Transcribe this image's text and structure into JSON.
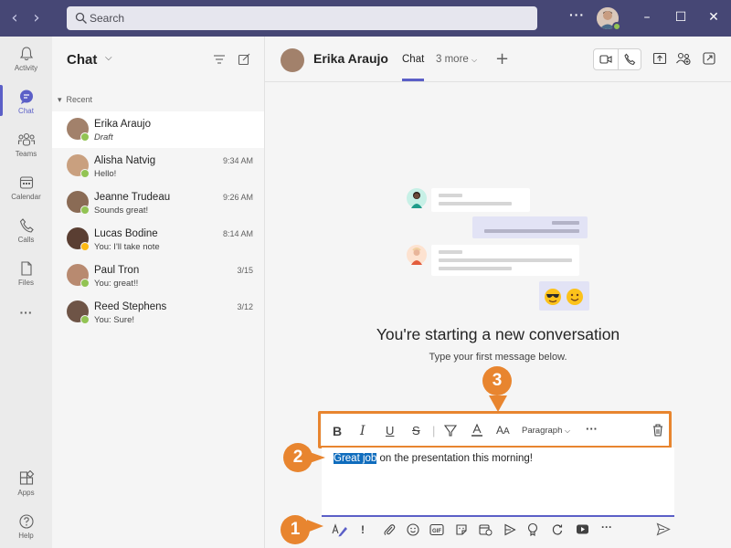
{
  "titlebar": {
    "search_placeholder": "Search",
    "more_label": "···"
  },
  "rail": {
    "items": [
      {
        "label": "Activity"
      },
      {
        "label": "Chat"
      },
      {
        "label": "Teams"
      },
      {
        "label": "Calendar"
      },
      {
        "label": "Calls"
      },
      {
        "label": "Files"
      },
      {
        "label": "···"
      },
      {
        "label": "Apps"
      },
      {
        "label": "Help"
      }
    ]
  },
  "chatlist": {
    "title": "Chat",
    "section": "Recent",
    "rows": [
      {
        "name": "Erika Araujo",
        "preview": "Draft",
        "time": "",
        "presence": "#92c353",
        "avatar_color": "#a2816b"
      },
      {
        "name": "Alisha Natvig",
        "preview": "Hello!",
        "time": "9:34 AM",
        "presence": "#92c353",
        "avatar_color": "#c9a07f"
      },
      {
        "name": "Jeanne Trudeau",
        "preview": "Sounds great!",
        "time": "9:26 AM",
        "presence": "#92c353",
        "avatar_color": "#8a6b55"
      },
      {
        "name": "Lucas Bodine",
        "preview": "You: I'll take note",
        "time": "8:14 AM",
        "presence": "#fdb913",
        "avatar_color": "#5a3e32"
      },
      {
        "name": "Paul Tron",
        "preview": "You: great!!",
        "time": "3/15",
        "presence": "#92c353",
        "avatar_color": "#b88a70"
      },
      {
        "name": "Reed Stephens",
        "preview": "You: Sure!",
        "time": "3/12",
        "presence": "#92c353",
        "avatar_color": "#6e5446"
      }
    ]
  },
  "header": {
    "name": "Erika Araujo",
    "tab_active": "Chat",
    "tab_more": "3 more"
  },
  "empty_state": {
    "title": "You're starting a new conversation",
    "subtitle": "Type your first message below."
  },
  "compose": {
    "selected_text": "Great job",
    "rest_text": " on the presentation this morning!",
    "paragraph_label": "Paragraph"
  },
  "callouts": [
    "1",
    "2",
    "3"
  ],
  "colors": {
    "brand": "#464775",
    "accent": "#5b5fc7",
    "callout": "#e8852f",
    "available": "#92c353",
    "away": "#fdb913"
  }
}
